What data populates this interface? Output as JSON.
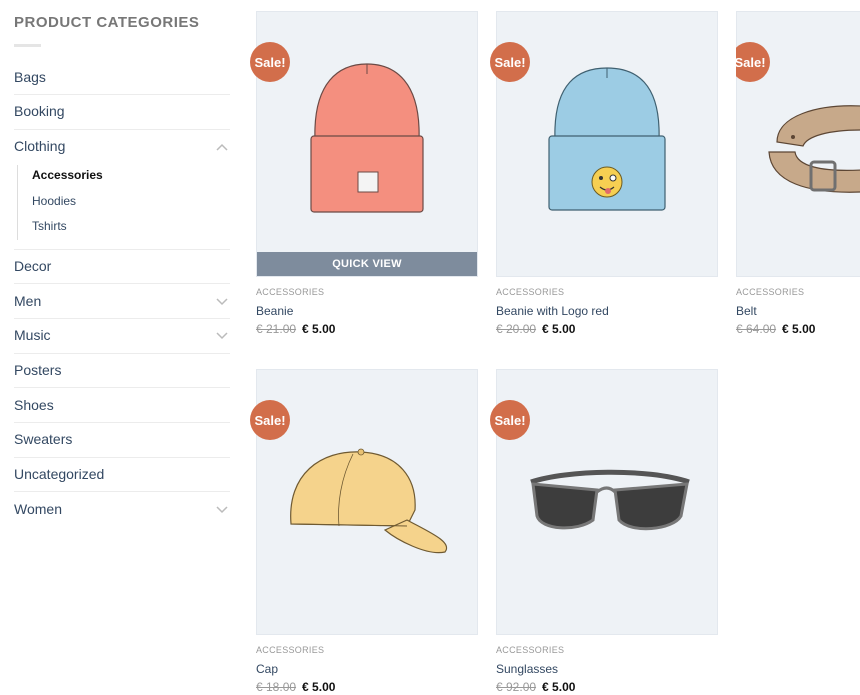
{
  "sidebar": {
    "title": "PRODUCT CATEGORIES",
    "categories": [
      {
        "label": "Bags"
      },
      {
        "label": "Booking"
      },
      {
        "label": "Clothing"
      },
      {
        "label": "Decor"
      },
      {
        "label": "Men"
      },
      {
        "label": "Music"
      },
      {
        "label": "Posters"
      },
      {
        "label": "Shoes"
      },
      {
        "label": "Sweaters"
      },
      {
        "label": "Uncategorized"
      },
      {
        "label": "Women"
      }
    ],
    "subcategories": [
      {
        "label": "Accessories"
      },
      {
        "label": "Hoodies"
      },
      {
        "label": "Tshirts"
      }
    ]
  },
  "products": [
    {
      "name": "Beanie",
      "category": "ACCESSORIES",
      "old_price": "€ 21.00",
      "new_price": "€ 5.00",
      "badge": "Sale!",
      "quick_view": "QUICK VIEW"
    },
    {
      "name": "Beanie with Logo red",
      "category": "ACCESSORIES",
      "old_price": "€ 20.00",
      "new_price": "€ 5.00",
      "badge": "Sale!"
    },
    {
      "name": "Belt",
      "category": "ACCESSORIES",
      "old_price": "€ 64.00",
      "new_price": "€ 5.00",
      "badge": "Sale!"
    },
    {
      "name": "Cap",
      "category": "ACCESSORIES",
      "old_price": "€ 18.00",
      "new_price": "€ 5.00",
      "badge": "Sale!"
    },
    {
      "name": "Sunglasses",
      "category": "ACCESSORIES",
      "old_price": "€ 92.00",
      "new_price": "€ 5.00",
      "badge": "Sale!"
    }
  ],
  "colors": {
    "sale_badge": "#d26e4b",
    "link": "#334862"
  }
}
